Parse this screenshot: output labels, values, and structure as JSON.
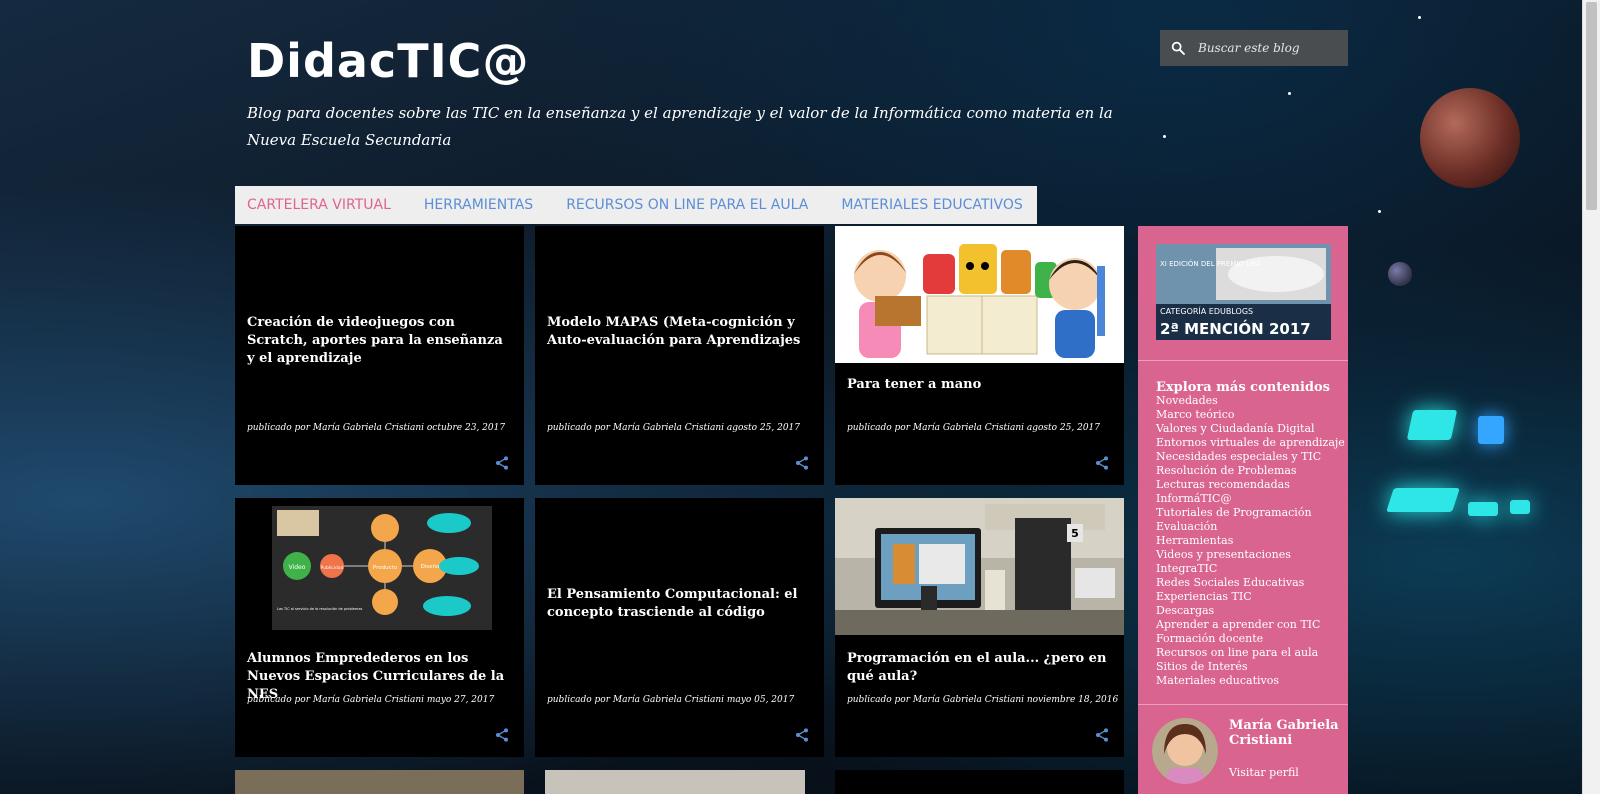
{
  "header": {
    "title": "DidacTIC@",
    "description": "Blog para docentes sobre las TIC en la enseñanza y el aprendizaje y el valor de la Informática como materia en la Nueva Escuela Secundaria"
  },
  "search": {
    "placeholder": "Buscar este blog",
    "icon": "search-icon"
  },
  "nav": {
    "items": [
      {
        "label": "CARTELERA VIRTUAL",
        "active": true
      },
      {
        "label": "HERRAMIENTAS"
      },
      {
        "label": "RECURSOS ON LINE PARA EL AULA"
      },
      {
        "label": "MATERIALES EDUCATIVOS"
      }
    ],
    "colors": {
      "active": "#e0648e",
      "default": "#5c8ed6"
    }
  },
  "posts": [
    {
      "title": "Creación de videojuegos con Scratch, aportes para la enseñanza y el aprendizaje",
      "byline": "publicado por María Gabriela Cristiani octubre 23, 2017"
    },
    {
      "title": "Modelo MAPAS (Meta-cognición y Auto-evaluación para Aprendizajes",
      "byline": "publicado por María Gabriela Cristiani agosto 25, 2017"
    },
    {
      "title": "Para tener a mano",
      "byline": "publicado por María Gabriela Cristiani agosto 25, 2017"
    },
    {
      "title": "Alumnos Empredederos en los Nuevos Espacios Curriculares de la NES",
      "byline": "publicado por María Gabriela Cristiani mayo 27, 2017"
    },
    {
      "title": "El Pensamiento Computacional: el concepto trasciende al código",
      "byline": "publicado por María Gabriela Cristiani mayo 05, 2017"
    },
    {
      "title": "Programación en el aula... ¿pero en qué aula?",
      "byline": "publicado por María Gabriela Cristiani noviembre 18, 2016"
    }
  ],
  "badge": {
    "line1": "XI EDICIÓN DEL PREMIO UBA",
    "line2": "CATEGORÍA EDUBLOGS",
    "line3": "2ª MENCIÓN 2017"
  },
  "diagram": {
    "center": "Producto",
    "left": "Video",
    "left2": "Publicidad",
    "right": "Diseño",
    "caption": "Las TIC al servicio de la resolución de problemas"
  },
  "sidebar": {
    "links_title": "Explora más contenidos",
    "links": [
      "Novedades",
      "Marco teórico",
      "Valores y Ciudadanía Digital",
      "Entornos virtuales de aprendizaje",
      "Necesidades especiales y TIC",
      "Resolución de Problemas",
      "Lecturas recomendadas",
      "InformáTIC@",
      "Tutoriales de Programación",
      "Evaluación",
      "Herramientas",
      "Videos y presentaciones",
      "IntegraTIC",
      "Redes Sociales Educativas",
      "Experiencias TIC",
      "Descargas",
      "Aprender a aprender con TIC",
      "Formación docente",
      "Recursos on line para el aula",
      "Sitios de Interés",
      "Materiales educativos"
    ],
    "background": "#d9648f"
  },
  "profile": {
    "name": "María Gabriela Cristiani",
    "link": "Visitar perfil"
  },
  "thumb_label": "5"
}
